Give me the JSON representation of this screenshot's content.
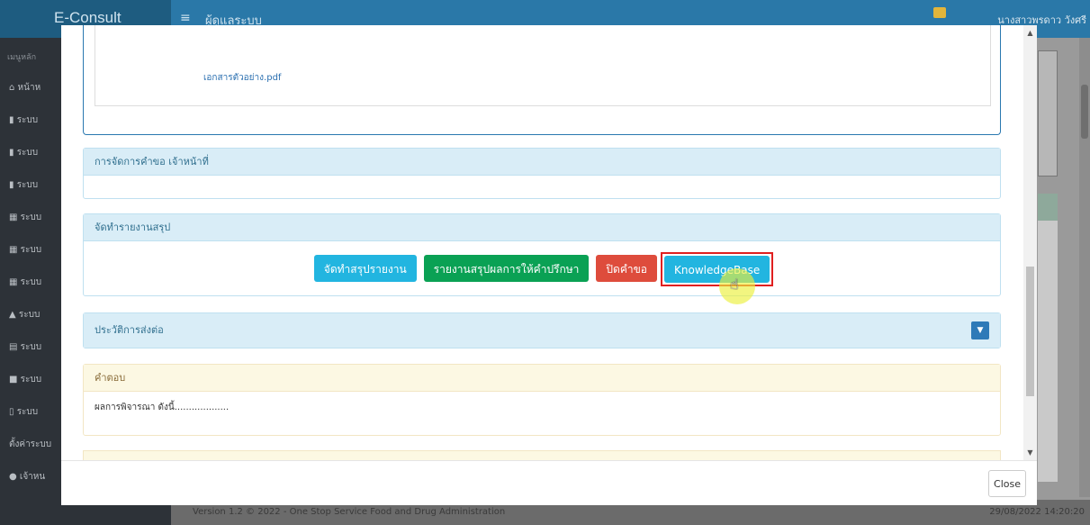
{
  "app": {
    "logo": "E-Consult",
    "menu_icon": "hamburger-icon",
    "section_title": "ผู้ดูแลระบบ",
    "user_name": "นางสาวพรดาว วังศรี",
    "sidebar": {
      "heading": "เมนูหลัก",
      "items": [
        {
          "icon": "home-icon",
          "label": "หน้าห"
        },
        {
          "icon": "book-icon",
          "label": "ระบบ"
        },
        {
          "icon": "book-icon",
          "label": "ระบบ"
        },
        {
          "icon": "book-icon",
          "label": "ระบบ"
        },
        {
          "icon": "calendar-icon",
          "label": "ระบบ"
        },
        {
          "icon": "calendar-icon",
          "label": "ระบบ"
        },
        {
          "icon": "calendar-icon",
          "label": "ระบบ"
        },
        {
          "icon": "graduation-cap-icon",
          "label": "ระบบ"
        },
        {
          "icon": "table-icon",
          "label": "ระบบ"
        },
        {
          "icon": "video-icon",
          "label": "ระบบ"
        },
        {
          "icon": "file-icon",
          "label": "ระบบ"
        },
        {
          "icon": "",
          "label": "ตั้งค่าระบบ"
        },
        {
          "icon": "user-icon",
          "label": "เจ้าหน"
        }
      ]
    },
    "footer": {
      "version": "Version 1.2 © 2022 - One Stop Service Food and Drug Administration",
      "timestamp": "29/08/2022 14:20:20"
    }
  },
  "modal": {
    "attachment_link": "เอกสารตัวอย่าง.pdf",
    "manage_panel": {
      "title": "การจัดการคำขอ เจ้าหน้าที่"
    },
    "summary_panel": {
      "title": "จัดทำรายงานสรุป",
      "buttons": {
        "make_report": "จัดทำสรุปรายงาน",
        "consult_report": "รายงานสรุปผลการให้คำปรึกษา",
        "close_request": "ปิดคำขอ",
        "knowledge_base": "KnowledgeBase"
      }
    },
    "history_panel": {
      "title": "ประวัติการส่งต่อ",
      "toggle_icon": "chevron-down-icon"
    },
    "answer_panel": {
      "title": "คำตอบ",
      "text": "ผลการพิจารณา ดังนี้..................."
    },
    "close_label": "Close"
  },
  "colors": {
    "primary_blue": "#2a78a8",
    "info": "#22b5e0",
    "success": "#0aa154",
    "danger": "#de4c3c",
    "highlight_outline": "#e02020"
  }
}
